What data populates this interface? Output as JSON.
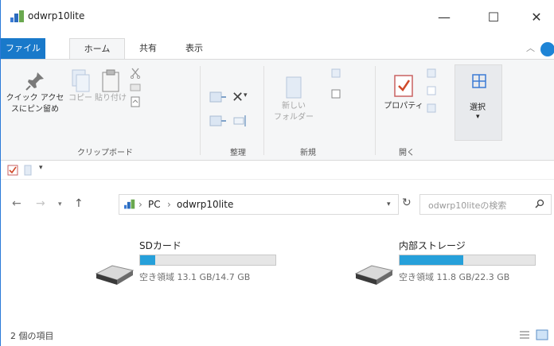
{
  "window": {
    "title": "odwrp10lite",
    "controls": {
      "minimize": "—",
      "maximize": "☐",
      "close": "✕"
    }
  },
  "ribbon_tabs": [
    "ファイル",
    "ホーム",
    "共有",
    "表示"
  ],
  "ribbon": {
    "clipboard": {
      "pin_label_1": "クイック アクセ",
      "pin_label_2": "スにピン留め",
      "copy_label": "コピー",
      "paste_label": "貼り付け",
      "group": "クリップボード"
    },
    "organize": {
      "group": "整理"
    },
    "new": {
      "new_folder_1": "新しい",
      "new_folder_2": "フォルダー",
      "group": "新規"
    },
    "open": {
      "properties": "プロパティ",
      "group": "開く"
    },
    "select": {
      "label": "選択"
    }
  },
  "address": {
    "crumbs": [
      "PC",
      "odwrp10lite"
    ],
    "search_placeholder": "odwrp10liteの検索"
  },
  "drives": [
    {
      "name": "SDカード",
      "free_text": "空き領域 13.1 GB/14.7 GB",
      "used_fraction": 0.11
    },
    {
      "name": "内部ストレージ",
      "free_text": "空き領域 11.8 GB/22.3 GB",
      "used_fraction": 0.47
    }
  ],
  "status": {
    "item_count": "2 個の項目"
  },
  "colors": {
    "accent": "#1979ca",
    "bar_fill": "#26a0da"
  }
}
